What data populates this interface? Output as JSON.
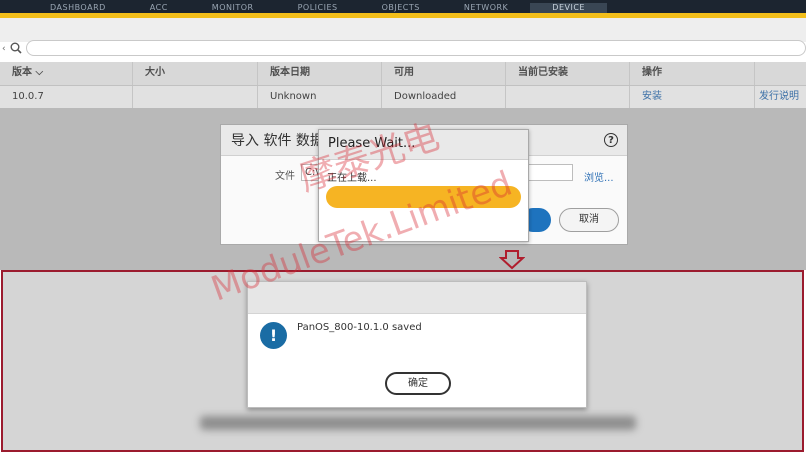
{
  "nav": {
    "tabs": [
      "DASHBOARD",
      "ACC",
      "MONITOR",
      "POLICIES",
      "OBJECTS",
      "NETWORK",
      "DEVICE"
    ],
    "active_tab": "DEVICE"
  },
  "table": {
    "headers": [
      "版本",
      "大小",
      "版本日期",
      "可用",
      "当前已安装",
      "操作",
      ""
    ],
    "rows": [
      {
        "version": "10.0.7",
        "size": "",
        "date": "Unknown",
        "available": "Downloaded",
        "installed": "",
        "action": "安装",
        "notes": "发行说明"
      }
    ]
  },
  "import_dialog": {
    "title": "导入 软件 数据",
    "file_label": "文件",
    "file_value": "C:\\",
    "browse": "浏览...",
    "cancel": "取消"
  },
  "wait_dialog": {
    "title": "Please Wait...",
    "message": "正在上载...",
    "progress": 1.0
  },
  "saved_dialog": {
    "message": "PanOS_800-10.1.0 saved",
    "confirm": "确定"
  },
  "watermark": {
    "line1": "摩泰光电",
    "line2": "ModuleTek.Limited"
  },
  "colors": {
    "accent_yellow": "#f2be1a",
    "link_blue": "#2c6fb5",
    "info_blue": "#1a6ca4",
    "frame_red": "#9b1b2e",
    "progress_orange": "#f6b423"
  }
}
